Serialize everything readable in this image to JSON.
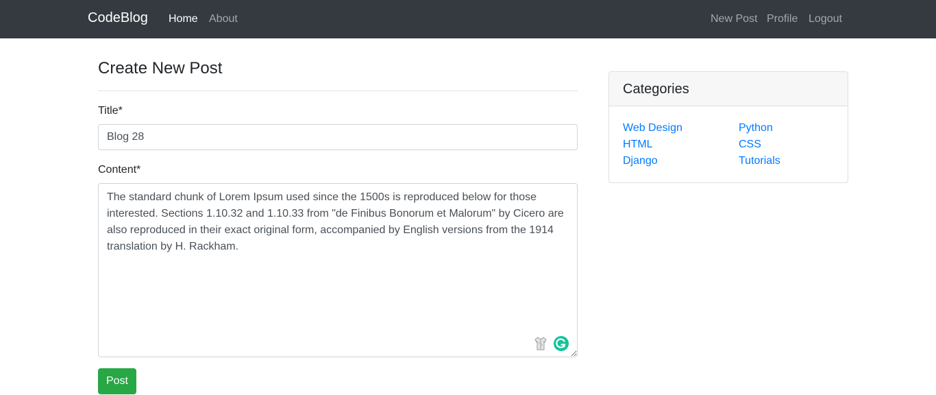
{
  "navbar": {
    "brand": "CodeBlog",
    "left_links": [
      {
        "label": "Home",
        "active": true
      },
      {
        "label": "About",
        "active": false
      }
    ],
    "right_links": [
      {
        "label": "New Post"
      },
      {
        "label": "Profile"
      },
      {
        "label": "Logout"
      }
    ]
  },
  "form": {
    "heading": "Create New Post",
    "title_label": "Title*",
    "title_value": "Blog 28",
    "content_label": "Content*",
    "content_value": "The standard chunk of Lorem Ipsum used since the 1500s is reproduced below for those interested. Sections 1.10.32 and 1.10.33 from \"de Finibus Bonorum et Malorum\" by Cicero are also reproduced in their exact original form, accompanied by English versions from the 1914 translation by H. Rackham.",
    "submit_label": "Post"
  },
  "sidebar": {
    "title": "Categories",
    "categories": [
      "Web Design",
      "Python",
      "HTML",
      "CSS",
      "Django",
      "Tutorials"
    ]
  },
  "icons": {
    "content_extension": "shirt-icon",
    "grammar_checker": "grammarly-icon"
  },
  "colors": {
    "navbar_bg": "#343a40",
    "link": "#007bff",
    "submit_button": "#28a745",
    "grammarly": "#15c39a"
  }
}
